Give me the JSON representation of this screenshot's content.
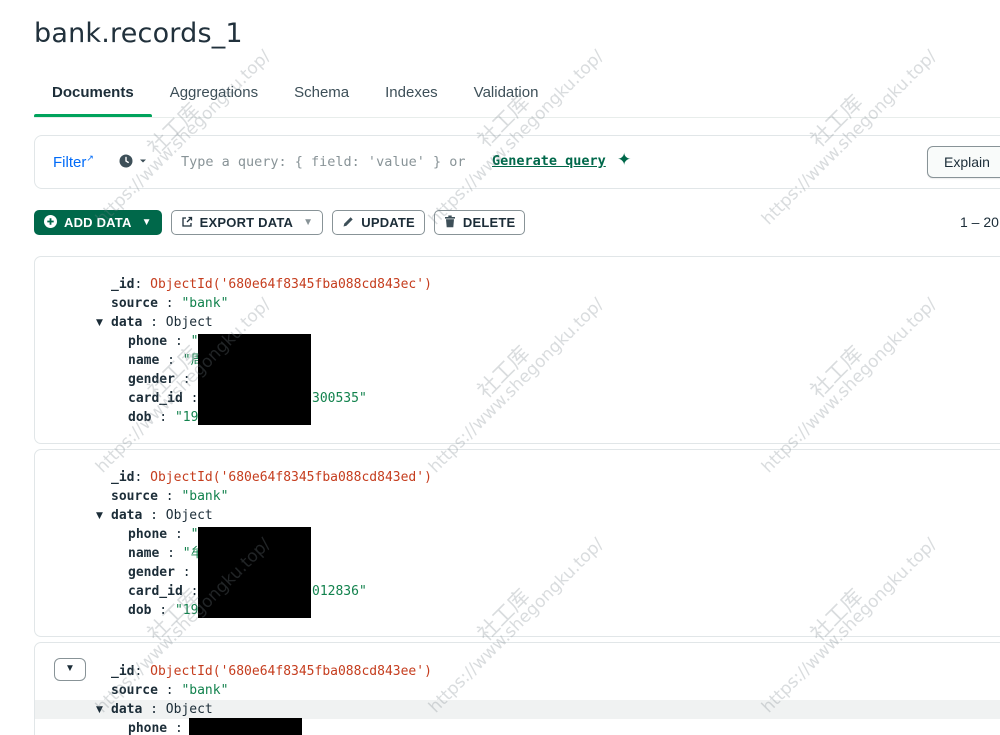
{
  "collection_title": "bank.records_1",
  "tabs": [
    "Documents",
    "Aggregations",
    "Schema",
    "Indexes",
    "Validation"
  ],
  "filter": {
    "label": "Filter",
    "placeholder_prefix": "Type a query: { field: 'value' } or",
    "generate_query_link": "Generate query",
    "explain_button": "Explain"
  },
  "toolbar": {
    "add_data": "ADD DATA",
    "export_data": "EXPORT DATA",
    "update": "UPDATE",
    "delete": "DELETE",
    "pagination": "1 – 20"
  },
  "documents": [
    {
      "id_key": "_id",
      "id_value": "ObjectId('680e64f8345fba088cd843ec')",
      "source_key": "source",
      "source_value": "\"bank\"",
      "data_key": "data",
      "data_type": "Object",
      "fields": [
        {
          "key": "phone",
          "value": "\""
        },
        {
          "key": "name",
          "value": "\"周"
        },
        {
          "key": "gender",
          "value": ""
        },
        {
          "key": "card_id",
          "value": "300535\""
        },
        {
          "key": "dob",
          "value": "\"19"
        }
      ]
    },
    {
      "id_key": "_id",
      "id_value": "ObjectId('680e64f8345fba088cd843ed')",
      "source_key": "source",
      "source_value": "\"bank\"",
      "data_key": "data",
      "data_type": "Object",
      "fields": [
        {
          "key": "phone",
          "value": "\""
        },
        {
          "key": "name",
          "value": "\"牟"
        },
        {
          "key": "gender",
          "value": ""
        },
        {
          "key": "card_id",
          "value": "012836\""
        },
        {
          "key": "dob",
          "value": "\"19"
        }
      ]
    },
    {
      "id_key": "_id",
      "id_value": "ObjectId('680e64f8345fba088cd843ee')",
      "source_key": "source",
      "source_value": "\"bank\"",
      "data_key": "data",
      "data_type": "Object",
      "fields": [
        {
          "key": "phone",
          "value": ""
        }
      ]
    }
  ],
  "watermark": {
    "url": "https://www.shegongku.top/",
    "cn": "社工库"
  },
  "colors": {
    "accent_green": "#00684a",
    "tab_underline": "#00a35c",
    "object_id": "#c53d1e",
    "string_value": "#12824d",
    "link_blue": "#016bf8"
  }
}
